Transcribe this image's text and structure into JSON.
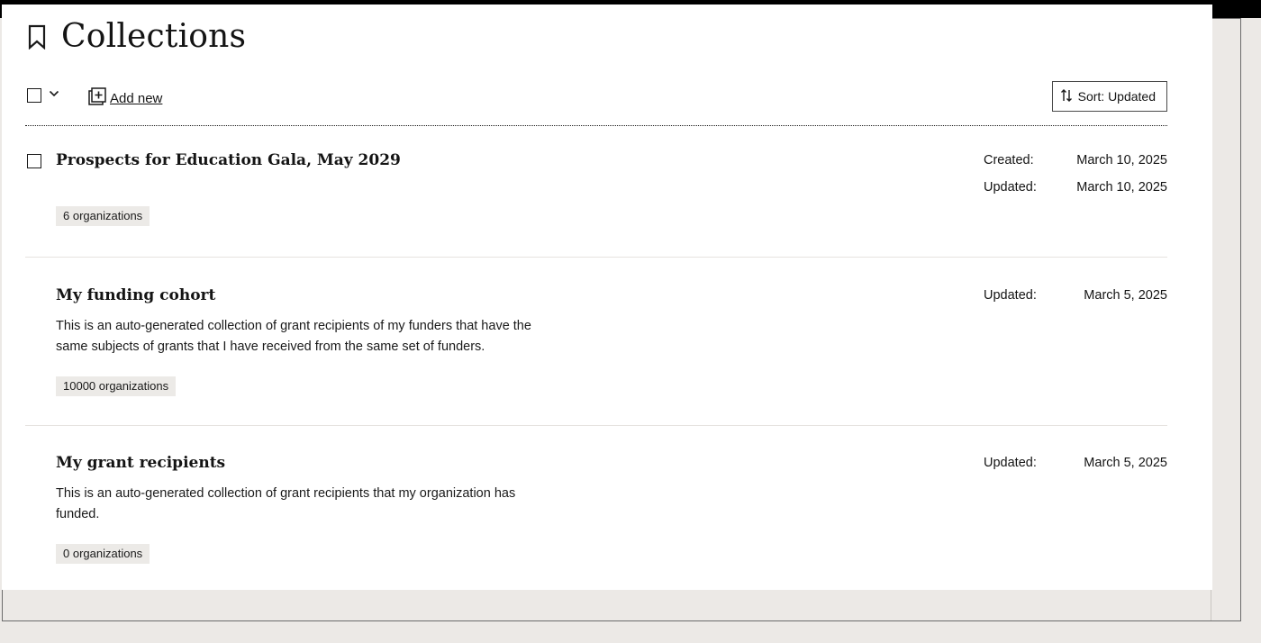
{
  "page": {
    "title": "Collections",
    "icon": "bookmark-icon"
  },
  "toolbar": {
    "add_new_label": "Add new",
    "sort_label": "Sort: Updated"
  },
  "collections": [
    {
      "title": "Prospects for Education Gala, May 2029",
      "description": "",
      "count_label": "6 organizations",
      "has_checkbox": true,
      "created_key": "Created:",
      "created_value": "March 10, 2025",
      "updated_key": "Updated:",
      "updated_value": "March 10, 2025"
    },
    {
      "title": "My funding cohort",
      "description": "This is an auto-generated collection of grant recipients of my funders that have the same subjects of grants that I have received from the same set of funders.",
      "count_label": "10000 organizations",
      "has_checkbox": false,
      "updated_key": "Updated:",
      "updated_value": "March 5, 2025"
    },
    {
      "title": "My grant recipients",
      "description": "This is an auto-generated collection of grant recipients that my organization has funded.",
      "count_label": "0 organizations",
      "has_checkbox": false,
      "updated_key": "Updated:",
      "updated_value": "March 5, 2025"
    }
  ]
}
